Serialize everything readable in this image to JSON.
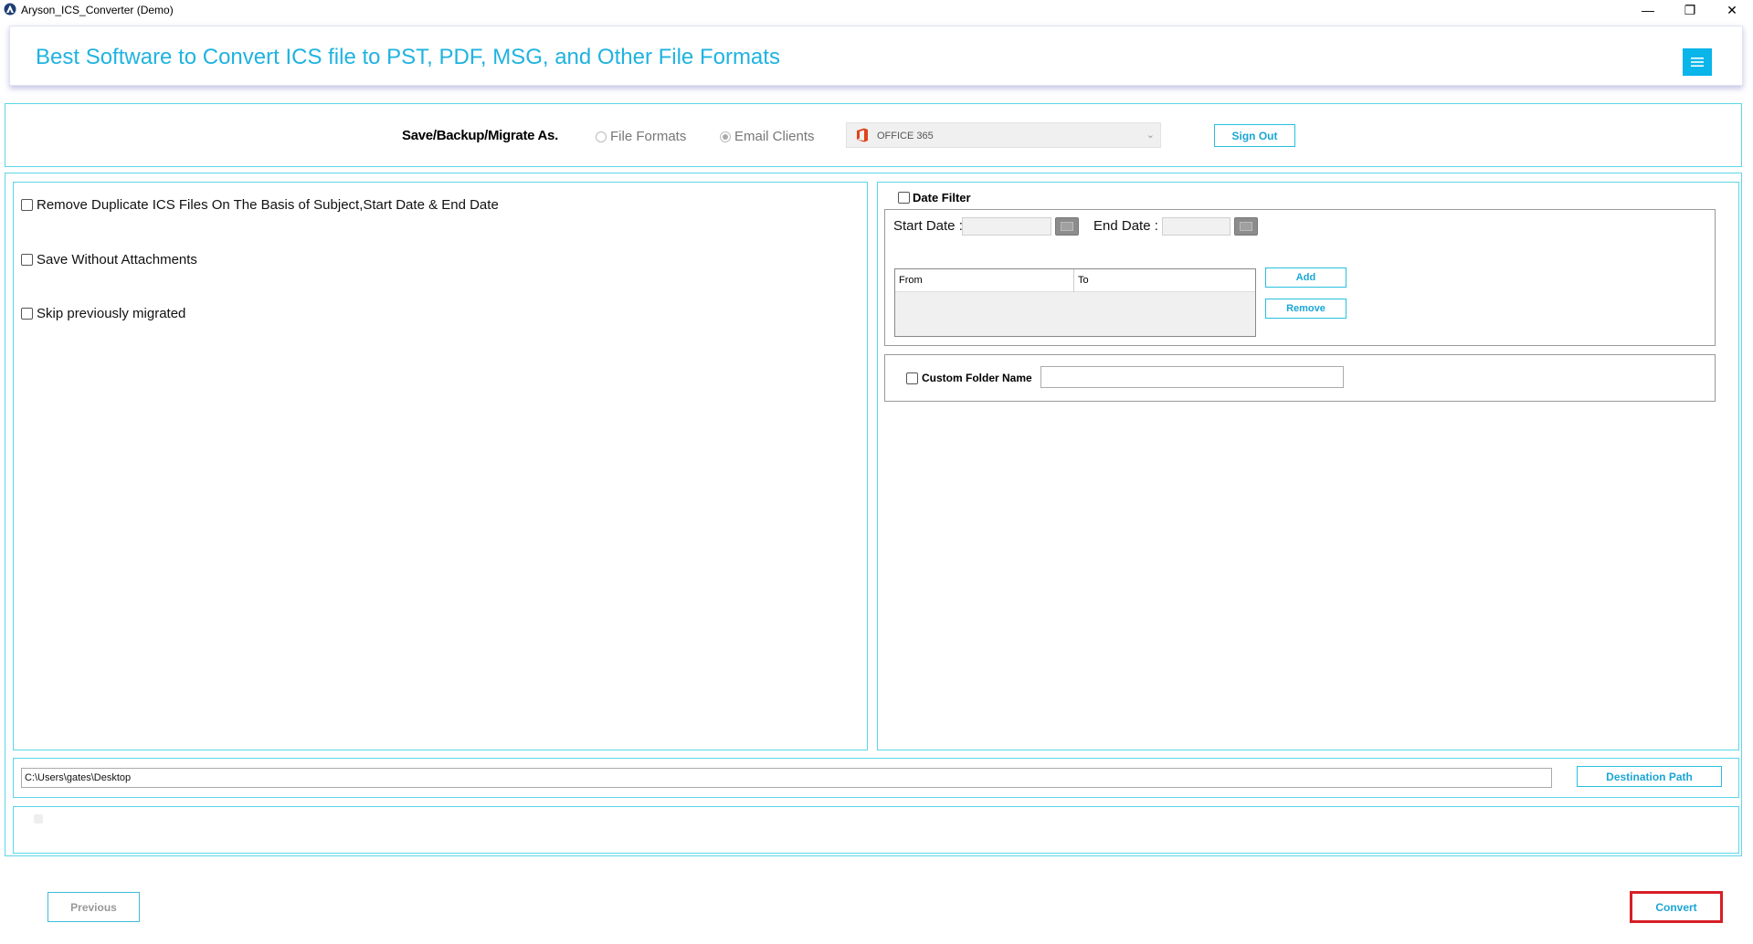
{
  "window": {
    "title": "Aryson_ICS_Converter (Demo)",
    "controls": {
      "minimize": "—",
      "restore": "❐",
      "close": "✕"
    }
  },
  "header": {
    "title": "Best Software to Convert ICS file to PST, PDF, MSG, and Other File Formats",
    "menu_icon": "hamburger-icon"
  },
  "save_as": {
    "label": "Save/Backup/Migrate As.",
    "options": [
      {
        "label": "File Formats",
        "selected": false
      },
      {
        "label": "Email Clients",
        "selected": true
      }
    ],
    "client_value": "OFFICE 365",
    "sign_out": "Sign Out"
  },
  "left_options": [
    {
      "label": "Remove Duplicate ICS Files On The Basis of Subject,Start Date & End Date",
      "checked": false
    },
    {
      "label": "Save Without Attachments",
      "checked": false
    },
    {
      "label": "Skip previously migrated",
      "checked": false
    }
  ],
  "date_filter": {
    "label": "Date Filter",
    "checked": false,
    "start_label": "Start Date :",
    "end_label": "End Date :",
    "table_headers": {
      "from": "From",
      "to": "To"
    },
    "add": "Add",
    "remove": "Remove"
  },
  "custom_folder": {
    "label": "Custom Folder Name",
    "checked": false,
    "value": ""
  },
  "destination": {
    "path": "C:\\Users\\gates\\Desktop",
    "button": "Destination Path"
  },
  "footer": {
    "previous": "Previous",
    "convert": "Convert"
  },
  "colors": {
    "accent": "#1fb3e0",
    "panel_border": "#5dd6e6",
    "menu_button": "#0ab5ea",
    "convert_highlight": "#d61f26"
  }
}
